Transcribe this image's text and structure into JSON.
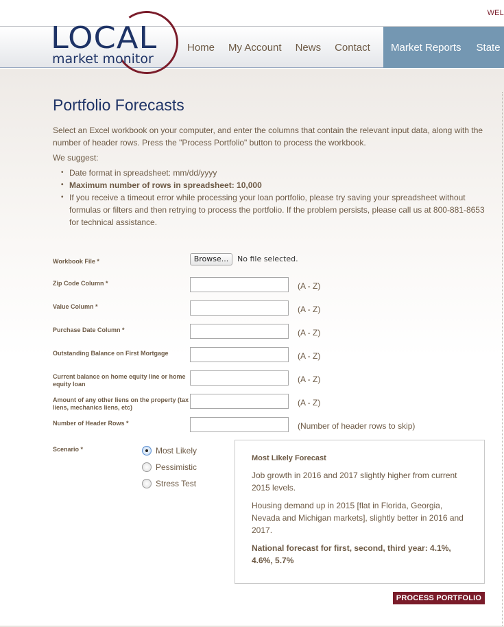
{
  "header": {
    "welcome_text": "WEL",
    "logo": {
      "top_text": "LOCAL",
      "sub_text": "market monitor"
    },
    "nav": [
      {
        "label": "Home"
      },
      {
        "label": "My Account"
      },
      {
        "label": "News"
      },
      {
        "label": "Contact"
      }
    ],
    "nav_active": [
      {
        "label": "Market Reports"
      },
      {
        "label": "State"
      }
    ]
  },
  "page": {
    "title": "Portfolio Forecasts",
    "intro": "Select an Excel workbook on your computer, and enter the columns that contain the relevant input data, along with the number of header rows. Press the \"Process Portfolio\" button to process the workbook.",
    "suggest_label": "We suggest:",
    "bullets": [
      "Date format in spreadsheet: mm/dd/yyyy",
      "Maximum number of rows in spreadsheet: 10,000",
      "If you receive a timeout error while processing your loan portfolio, please try saving your spreadsheet without formulas or filters and then retrying to process the portfolio. If the problem persists, please call us at 800-881-8653 for technical assistance."
    ]
  },
  "form": {
    "workbook": {
      "label": "Workbook File *",
      "browse_label": "Browse...",
      "file_status": "No file selected."
    },
    "fields": [
      {
        "label": "Zip Code Column *",
        "value": "",
        "hint": "(A - Z)"
      },
      {
        "label": "Value Column *",
        "value": "",
        "hint": "(A - Z)"
      },
      {
        "label": "Purchase Date Column *",
        "value": "",
        "hint": "(A - Z)"
      },
      {
        "label": "Outstanding Balance on First Mortgage",
        "value": "",
        "hint": "(A - Z)"
      },
      {
        "label": "Current balance on home equity line or home equity loan",
        "value": "",
        "hint": "(A - Z)"
      },
      {
        "label": "Amount of any other liens on the property (tax liens, mechanics liens, etc)",
        "value": "",
        "hint": "(A - Z)"
      },
      {
        "label": "Number of Header Rows *",
        "value": "",
        "hint": "(Number of header rows to skip)"
      }
    ],
    "scenario": {
      "label": "Scenario *",
      "options": [
        {
          "label": "Most Likely",
          "checked": true
        },
        {
          "label": "Pessimistic",
          "checked": false
        },
        {
          "label": "Stress Test",
          "checked": false
        }
      ]
    },
    "forecast": {
      "title": "Most Likely Forecast",
      "paragraphs": [
        "Job growth in 2016 and 2017 slightly higher from current 2015 levels.",
        "Housing demand up in 2015 [flat in Florida, Georgia, Nevada and Michigan markets], slightly better in 2016 and 2017."
      ],
      "national": "National forecast for first, second, third year: 4.1%, 4.6%, 5.7%"
    },
    "submit_label": "PROCESS PORTFOLIO"
  },
  "colors": {
    "brand_navy": "#1e3366",
    "brand_maroon": "#7a1c2a",
    "nav_active_bg": "#7497b2",
    "text_brown": "#6d5a45"
  }
}
